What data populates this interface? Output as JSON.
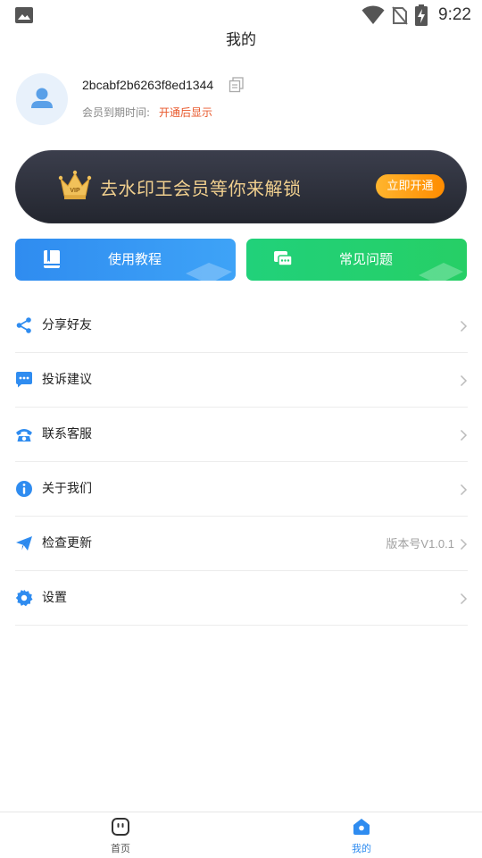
{
  "status_bar": {
    "time": "9:22"
  },
  "header": {
    "title": "我的"
  },
  "profile": {
    "user_id": "2bcabf2b6263f8ed1344",
    "expire_label": "会员到期时间:",
    "expire_value": "开通后显示"
  },
  "vip_banner": {
    "badge_text": "VIP",
    "text": "去水印王会员等你来解锁",
    "button_label": "立即开通"
  },
  "quick_actions": [
    {
      "label": "使用教程",
      "icon": "book-icon",
      "color": "#2f8cf0"
    },
    {
      "label": "常见问题",
      "icon": "chat-bubbles-icon",
      "color": "#22d074"
    }
  ],
  "menu": {
    "items": [
      {
        "label": "分享好友",
        "icon": "share-icon",
        "value": ""
      },
      {
        "label": "投诉建议",
        "icon": "message-icon",
        "value": ""
      },
      {
        "label": "联系客服",
        "icon": "phone-icon",
        "value": ""
      },
      {
        "label": "关于我们",
        "icon": "info-icon",
        "value": ""
      },
      {
        "label": "检查更新",
        "icon": "paper-plane-icon",
        "value": "版本号V1.0.1"
      },
      {
        "label": "设置",
        "icon": "gear-icon",
        "value": ""
      }
    ]
  },
  "tab_bar": {
    "tabs": [
      {
        "label": "首页",
        "icon": "home-face-icon",
        "active": false
      },
      {
        "label": "我的",
        "icon": "profile-house-icon",
        "active": true
      }
    ]
  },
  "colors": {
    "accent": "#2f8cf0",
    "green": "#22d074",
    "orange": "#ff9a1a",
    "highlight": "#e8582b"
  }
}
